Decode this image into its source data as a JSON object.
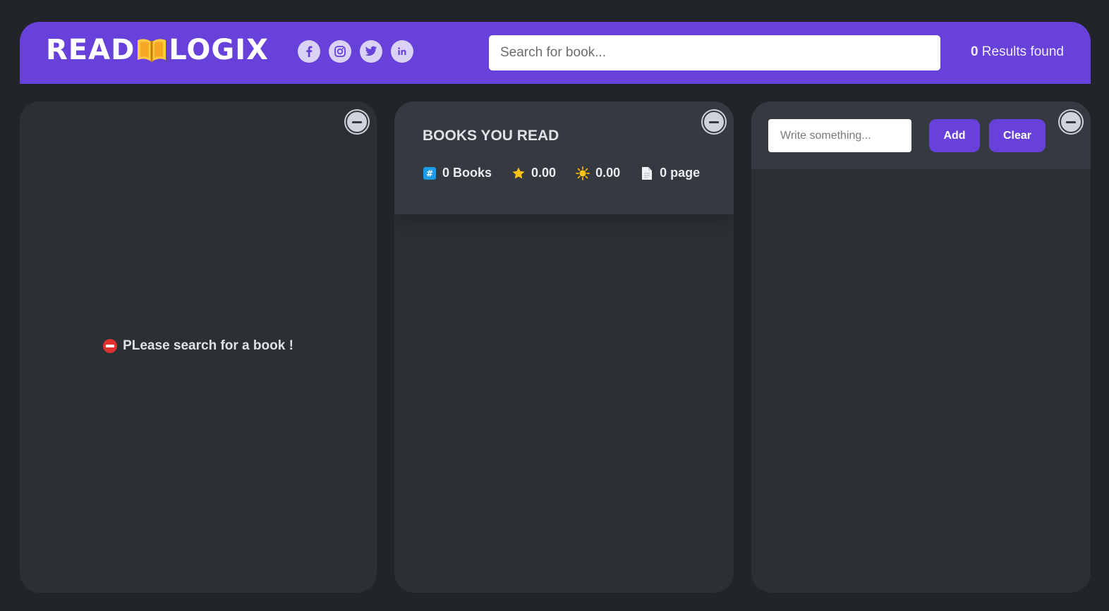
{
  "header": {
    "logo_left": "READ",
    "logo_right": "LOGIX",
    "socials": [
      {
        "name": "facebook-icon"
      },
      {
        "name": "instagram-icon"
      },
      {
        "name": "twitter-icon"
      },
      {
        "name": "linkedin-icon"
      }
    ],
    "search_placeholder": "Search for book...",
    "results_count": "0",
    "results_label": " Results found"
  },
  "search_box": {
    "empty_message": "PLease search for a book !"
  },
  "summary": {
    "title": "BOOKS YOU READ",
    "books": "0 Books",
    "avg_rating": "0.00",
    "avg_user_rating": "0.00",
    "pages": "0 page"
  },
  "notes": {
    "input_placeholder": "Write something...",
    "add_label": "Add",
    "clear_label": "Clear"
  },
  "colors": {
    "accent": "#6741d9",
    "background": "#212529",
    "box": "#2b3035",
    "box_header": "#343a40"
  }
}
